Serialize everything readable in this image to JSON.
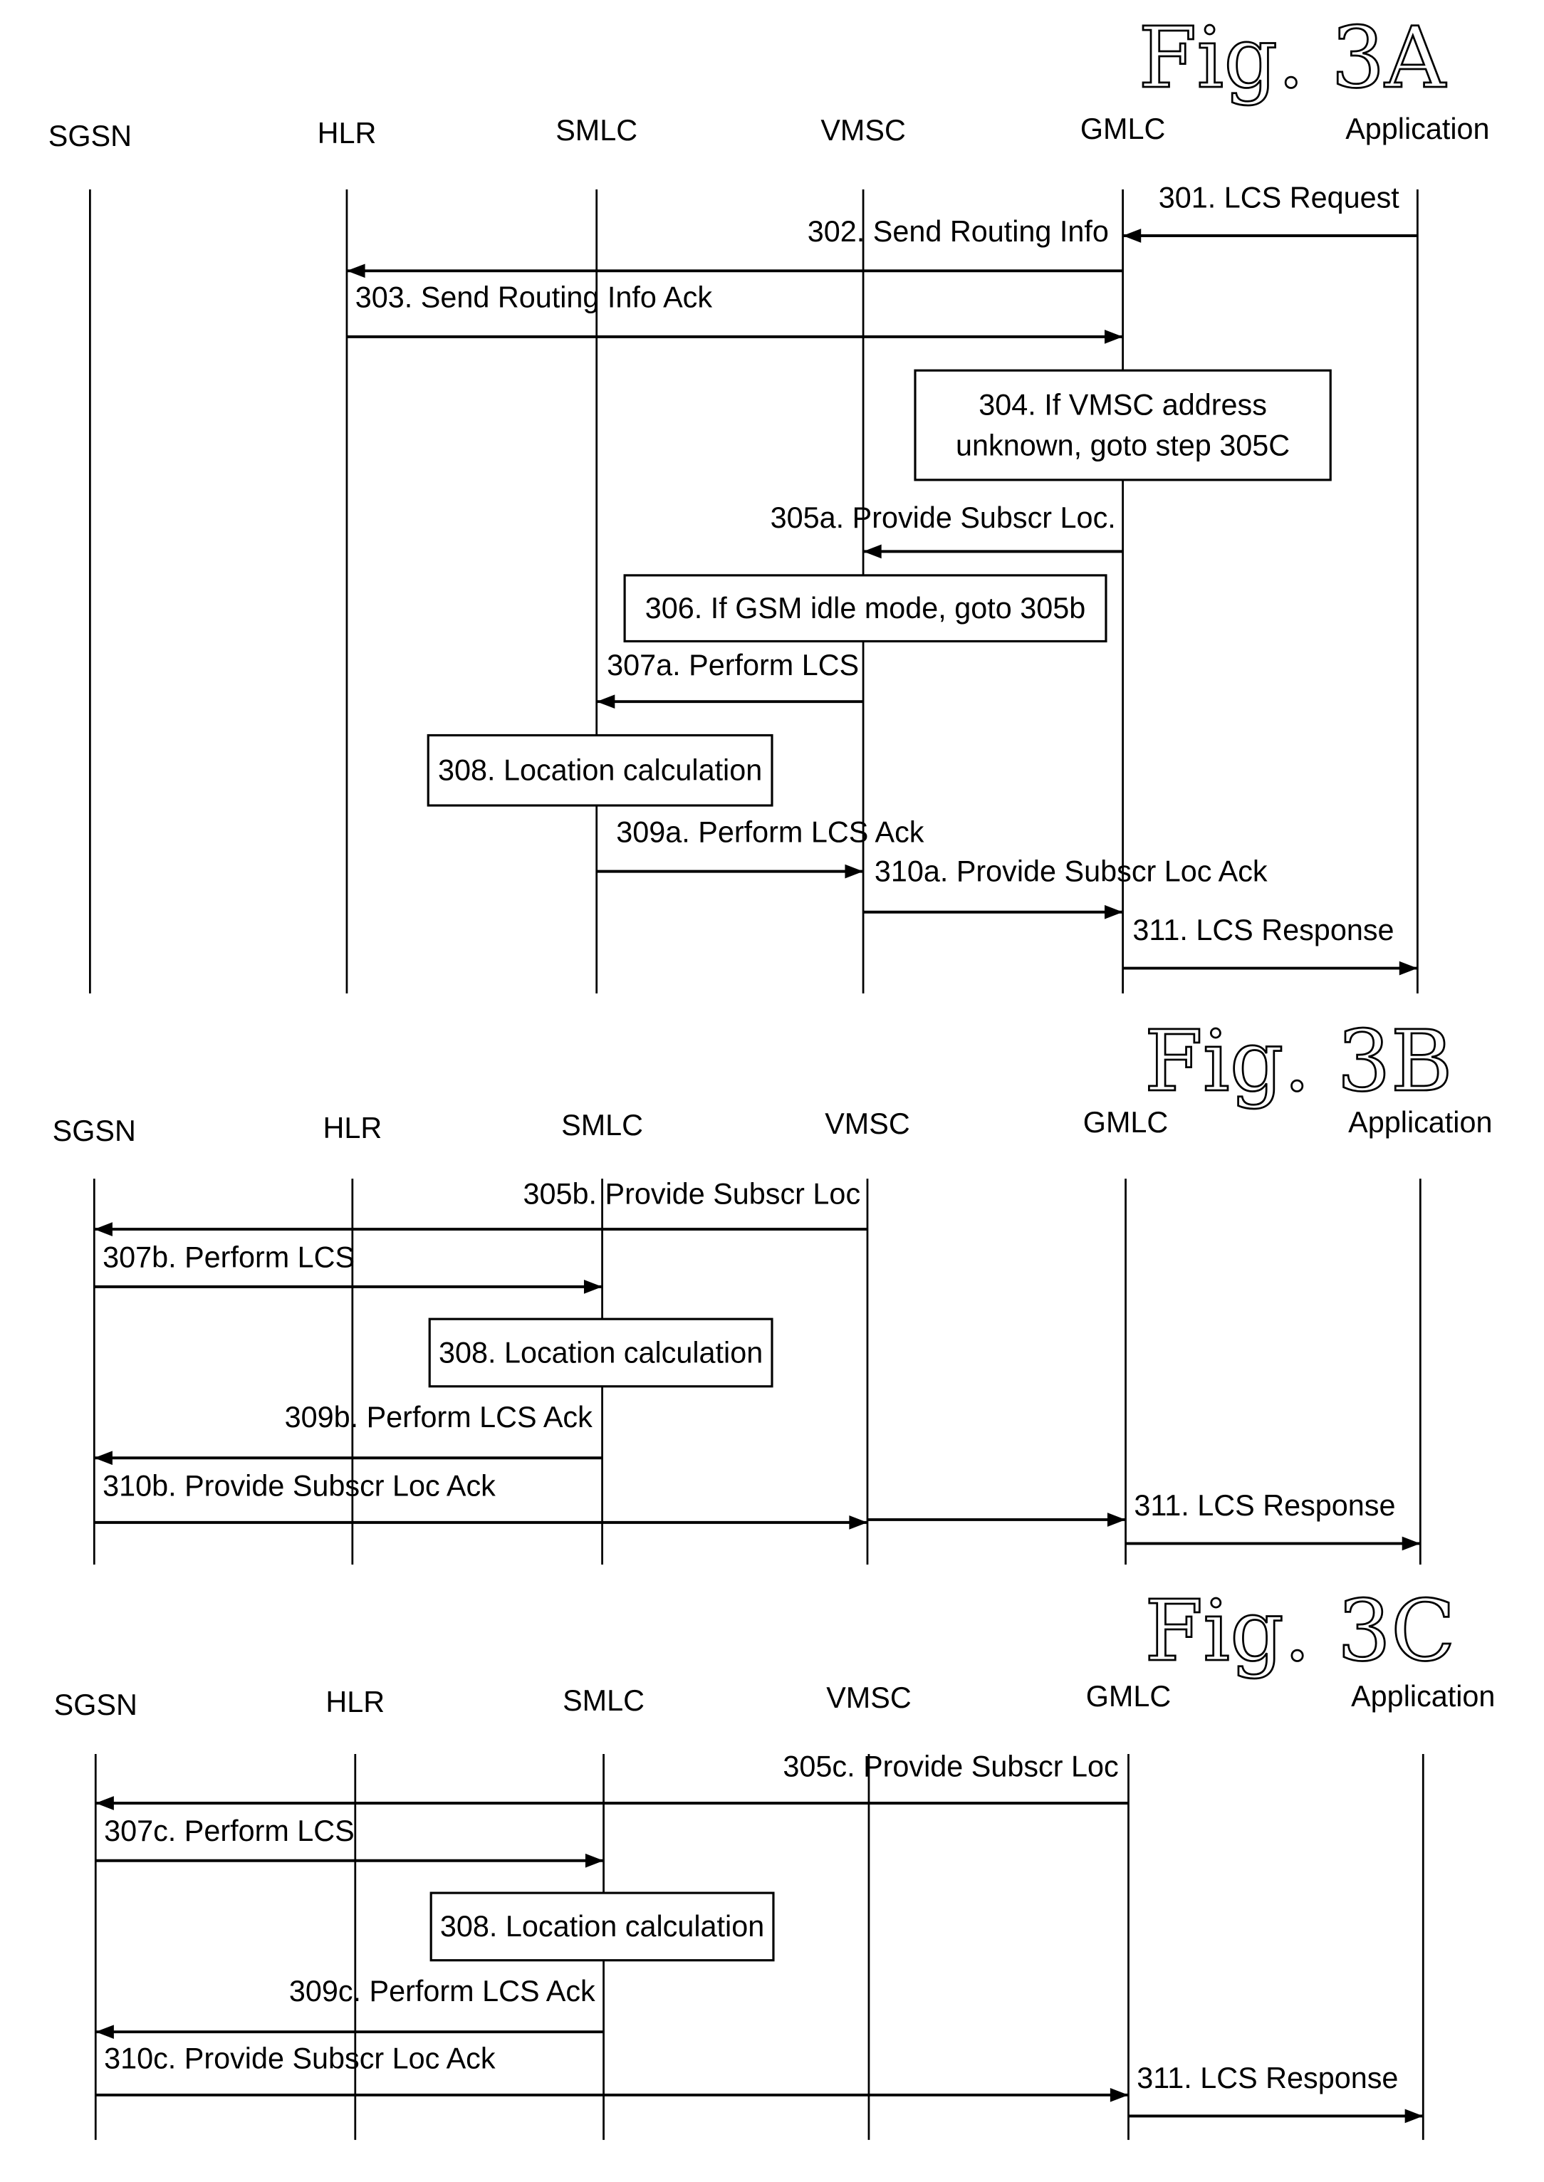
{
  "figures": [
    {
      "title": "Fig. 3A",
      "entities": [
        "SGSN",
        "HLR",
        "SMLC",
        "VMSC",
        "GMLC",
        "Application"
      ],
      "messages": [
        {
          "label": "301. LCS Request",
          "from": "Application",
          "to": "GMLC"
        },
        {
          "label": "302. Send Routing Info",
          "from": "GMLC",
          "to": "HLR"
        },
        {
          "label": "303. Send Routing Info Ack",
          "from": "HLR",
          "to": "GMLC"
        },
        {
          "label": "305a. Provide Subscr Loc.",
          "from": "GMLC",
          "to": "VMSC"
        },
        {
          "label": "307a. Perform LCS",
          "from": "VMSC",
          "to": "SMLC"
        },
        {
          "label": "309a. Perform LCS Ack",
          "from": "SMLC",
          "to": "VMSC"
        },
        {
          "label": "310a. Provide Subscr Loc Ack",
          "from": "VMSC",
          "to": "GMLC"
        },
        {
          "label": "311. LCS Response",
          "from": "GMLC",
          "to": "Application"
        }
      ],
      "boxes": [
        {
          "lines": [
            "304. If VMSC address",
            "unknown, goto step 305C"
          ]
        },
        {
          "lines": [
            "306. If GSM idle mode, goto 305b"
          ]
        },
        {
          "lines": [
            "308. Location calculation"
          ]
        }
      ]
    },
    {
      "title": "Fig. 3B",
      "entities": [
        "SGSN",
        "HLR",
        "SMLC",
        "VMSC",
        "GMLC",
        "Application"
      ],
      "messages": [
        {
          "label": "305b. Provide Subscr Loc",
          "from": "VMSC",
          "to": "SGSN"
        },
        {
          "label": "307b. Perform LCS",
          "from": "SGSN",
          "to": "SMLC"
        },
        {
          "label": "309b. Perform LCS Ack",
          "from": "SMLC",
          "to": "SGSN"
        },
        {
          "label": "310b. Provide Subscr Loc Ack",
          "from": "SGSN",
          "to": "GMLC"
        },
        {
          "label": "311. LCS Response",
          "from": "GMLC",
          "to": "Application"
        }
      ],
      "boxes": [
        {
          "lines": [
            "308. Location calculation"
          ]
        }
      ]
    },
    {
      "title": "Fig. 3C",
      "entities": [
        "SGSN",
        "HLR",
        "SMLC",
        "VMSC",
        "GMLC",
        "Application"
      ],
      "messages": [
        {
          "label": "305c. Provide Subscr Loc",
          "from": "GMLC",
          "to": "SGSN"
        },
        {
          "label": "307c. Perform LCS",
          "from": "SGSN",
          "to": "SMLC"
        },
        {
          "label": "309c. Perform LCS Ack",
          "from": "SMLC",
          "to": "SGSN"
        },
        {
          "label": "310c. Provide Subscr Loc Ack",
          "from": "SGSN",
          "to": "GMLC"
        },
        {
          "label": "311. LCS Response",
          "from": "GMLC",
          "to": "Application"
        }
      ],
      "boxes": [
        {
          "lines": [
            "308. Location calculation"
          ]
        }
      ]
    }
  ]
}
